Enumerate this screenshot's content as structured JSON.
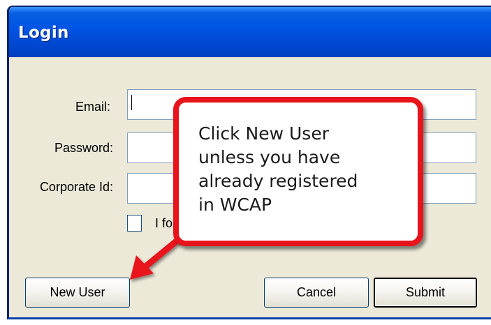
{
  "window": {
    "title": "Login"
  },
  "form": {
    "email_label": "Email:",
    "email_value": "",
    "password_label": "Password:",
    "password_value": "",
    "corporate_label": "Corporate Id:",
    "corporate_value": "",
    "checkbox_label": "I fo",
    "checkbox_checked": false
  },
  "buttons": {
    "new_user": "New User",
    "cancel": "Cancel",
    "submit": "Submit"
  },
  "callout": {
    "line1": "Click New User",
    "line2": "unless you have",
    "line3": "already registered",
    "line4": "in WCAP",
    "border_color": "#e8131b"
  },
  "colors": {
    "titlebar": "#0055e5",
    "dialog_bg": "#ece9d8"
  }
}
